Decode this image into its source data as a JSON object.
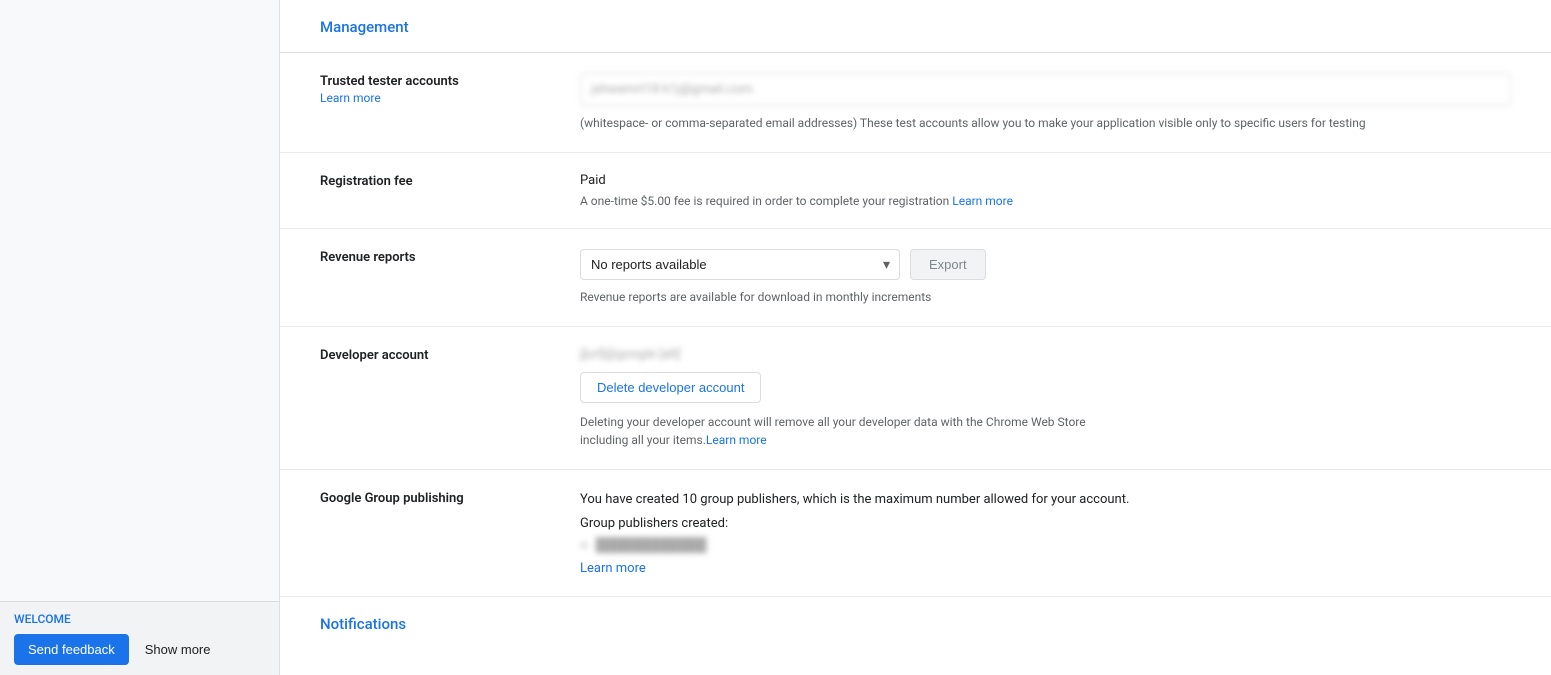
{
  "sidebar": {
    "welcome_text": "WELCOME",
    "send_feedback_label": "Send feedback",
    "show_more_label": "Show more"
  },
  "management": {
    "heading": "Management",
    "trusted_tester": {
      "label": "Trusted tester accounts",
      "learn_more": "Learn more",
      "email_placeholder": "jshwemrt18 k1j@gmail.com",
      "helper_text": "(whitespace- or comma-separated email addresses) These test accounts allow you to make your application visible only to specific users for testing"
    },
    "registration_fee": {
      "label": "Registration fee",
      "status": "Paid",
      "info_text": "A one-time $5.00 fee is required in order to complete your registration",
      "learn_more": "Learn more"
    },
    "revenue_reports": {
      "label": "Revenue reports",
      "dropdown_default": "No reports available",
      "export_label": "Export",
      "helper_text": "Revenue reports are available for download in monthly increments"
    },
    "developer_account": {
      "label": "Developer account",
      "email_blurred": "j[url]@google [alt]",
      "delete_button": "Delete developer account",
      "warning_text": "Deleting your developer account will remove all your developer data with the Chrome Web Store including all your items.",
      "learn_more": "Learn more"
    },
    "google_group_publishing": {
      "label": "Google Group publishing",
      "main_text": "You have created 10 group publishers, which is the maximum number allowed for your account.",
      "sub_text": "Group publishers created:",
      "group_blurred": "[blurred group name]",
      "learn_more": "Learn more"
    }
  },
  "notifications": {
    "heading": "Notifications"
  }
}
